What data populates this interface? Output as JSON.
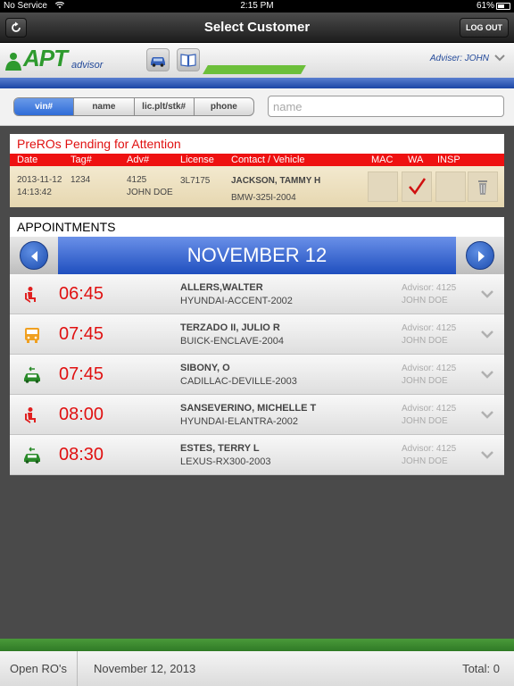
{
  "status_bar": {
    "carrier": "No Service",
    "time": "2:15 PM",
    "battery": "61%",
    "battery_level": 0.61
  },
  "nav": {
    "title": "Select Customer",
    "logout_label": "LOG OUT"
  },
  "header": {
    "logo_text": "APT",
    "logo_sub": "advisor",
    "adviser": "Adviser: JOHN"
  },
  "search": {
    "tabs": [
      "vin#",
      "name",
      "lic.plt/stk#",
      "phone"
    ],
    "active_tab": "vin#",
    "placeholder": "name",
    "value": ""
  },
  "preros": {
    "title": "PreROs Pending for Attention",
    "columns": [
      "Date",
      "Tag#",
      "Adv#",
      "License",
      "Contact / Vehicle",
      "MAC",
      "WA",
      "INSP"
    ],
    "row": {
      "date": "2013-11-12",
      "time": "14:13:42",
      "tag": "1234",
      "adv_no": "4125",
      "adv_name": "JOHN DOE",
      "license": "3L7175",
      "contact": "JACKSON, TAMMY H",
      "vehicle": "BMW-325I-2004",
      "wa_checked": true
    }
  },
  "appointments": {
    "title": "APPOINTMENTS",
    "date": "NOVEMBER 12",
    "items": [
      {
        "icon": "waiting-person-icon",
        "icon_color": "#e02020",
        "time": "06:45",
        "name": "ALLERS,WALTER",
        "vehicle": "HYUNDAI-ACCENT-2002",
        "advisor_no": "Advisor: 4125",
        "advisor_name": "JOHN DOE"
      },
      {
        "icon": "shuttle-bus-icon",
        "icon_color": "#f0a020",
        "time": "07:45",
        "name": "TERZADO II, JULIO R",
        "vehicle": "BUICK-ENCLAVE-2004",
        "advisor_no": "Advisor: 4125",
        "advisor_name": "JOHN DOE"
      },
      {
        "icon": "drop-off-car-icon",
        "icon_color": "#2a8a2a",
        "time": "07:45",
        "name": "SIBONY, O",
        "vehicle": "CADILLAC-DEVILLE-2003",
        "advisor_no": "Advisor: 4125",
        "advisor_name": "JOHN DOE"
      },
      {
        "icon": "waiting-person-icon",
        "icon_color": "#e02020",
        "time": "08:00",
        "name": "SANSEVERINO, MICHELLE T",
        "vehicle": "HYUNDAI-ELANTRA-2002",
        "advisor_no": "Advisor: 4125",
        "advisor_name": "JOHN DOE"
      },
      {
        "icon": "drop-off-car-icon",
        "icon_color": "#2a8a2a",
        "time": "08:30",
        "name": "ESTES, TERRY L",
        "vehicle": "LEXUS-RX300-2003",
        "advisor_no": "Advisor: 4125",
        "advisor_name": "JOHN DOE"
      }
    ]
  },
  "footer": {
    "open_ros": "Open RO's",
    "date": "November 12, 2013",
    "total": "Total: 0"
  },
  "colors": {
    "accent_red": "#e01010",
    "accent_blue": "#1f4fbf",
    "accent_green": "#2e9a2e"
  }
}
